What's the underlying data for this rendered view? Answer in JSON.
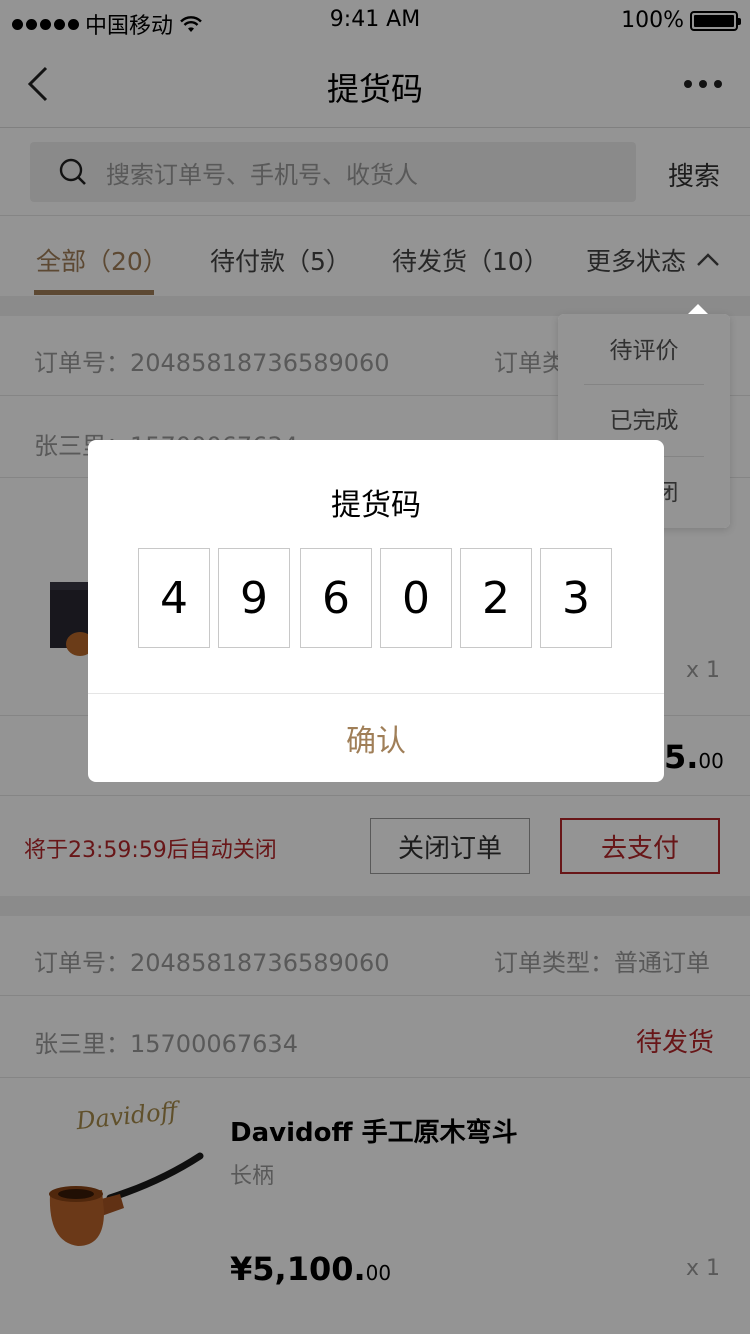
{
  "status_bar": {
    "carrier": "中国移动",
    "time": "9:41 AM",
    "battery": "100%",
    "battery_level": 1.0
  },
  "navbar": {
    "title": "提货码"
  },
  "search": {
    "placeholder": "搜索订单号、手机号、收货人",
    "button": "搜索"
  },
  "tabs": [
    {
      "label": "全部（20）"
    },
    {
      "label": "待付款（5）"
    },
    {
      "label": "待发货（10）"
    }
  ],
  "tab_more": {
    "label": "更多状态"
  },
  "dropdown": {
    "items": [
      "待评价",
      "已完成",
      "已关闭"
    ]
  },
  "order1": {
    "order_no": "订单号：20485818736589060",
    "order_type": "订单类型：普通订单",
    "customer": "张三里：15700067634",
    "qty": "x 1",
    "price_visible": "5.",
    "price_cents": "00",
    "countdown": "将于23:59:59后自动关闭",
    "close_btn": "关闭订单",
    "pay_btn": "去支付"
  },
  "order2": {
    "order_no": "订单号：20485818736589060",
    "order_type": "订单类型：普通订单",
    "customer": "张三里：15700067634",
    "status": "待发货",
    "brand": "Davidoff",
    "product_name": "Davidoff 手工原木弯斗",
    "spec": "长柄",
    "price": "¥5,100.",
    "price_cents": "00",
    "qty": "x 1"
  },
  "dialog": {
    "title": "提货码",
    "digits": [
      "4",
      "9",
      "6",
      "0",
      "2",
      "3"
    ],
    "confirm": "确认"
  },
  "colors": {
    "accent": "#a07f58",
    "alert": "#b3262a"
  }
}
